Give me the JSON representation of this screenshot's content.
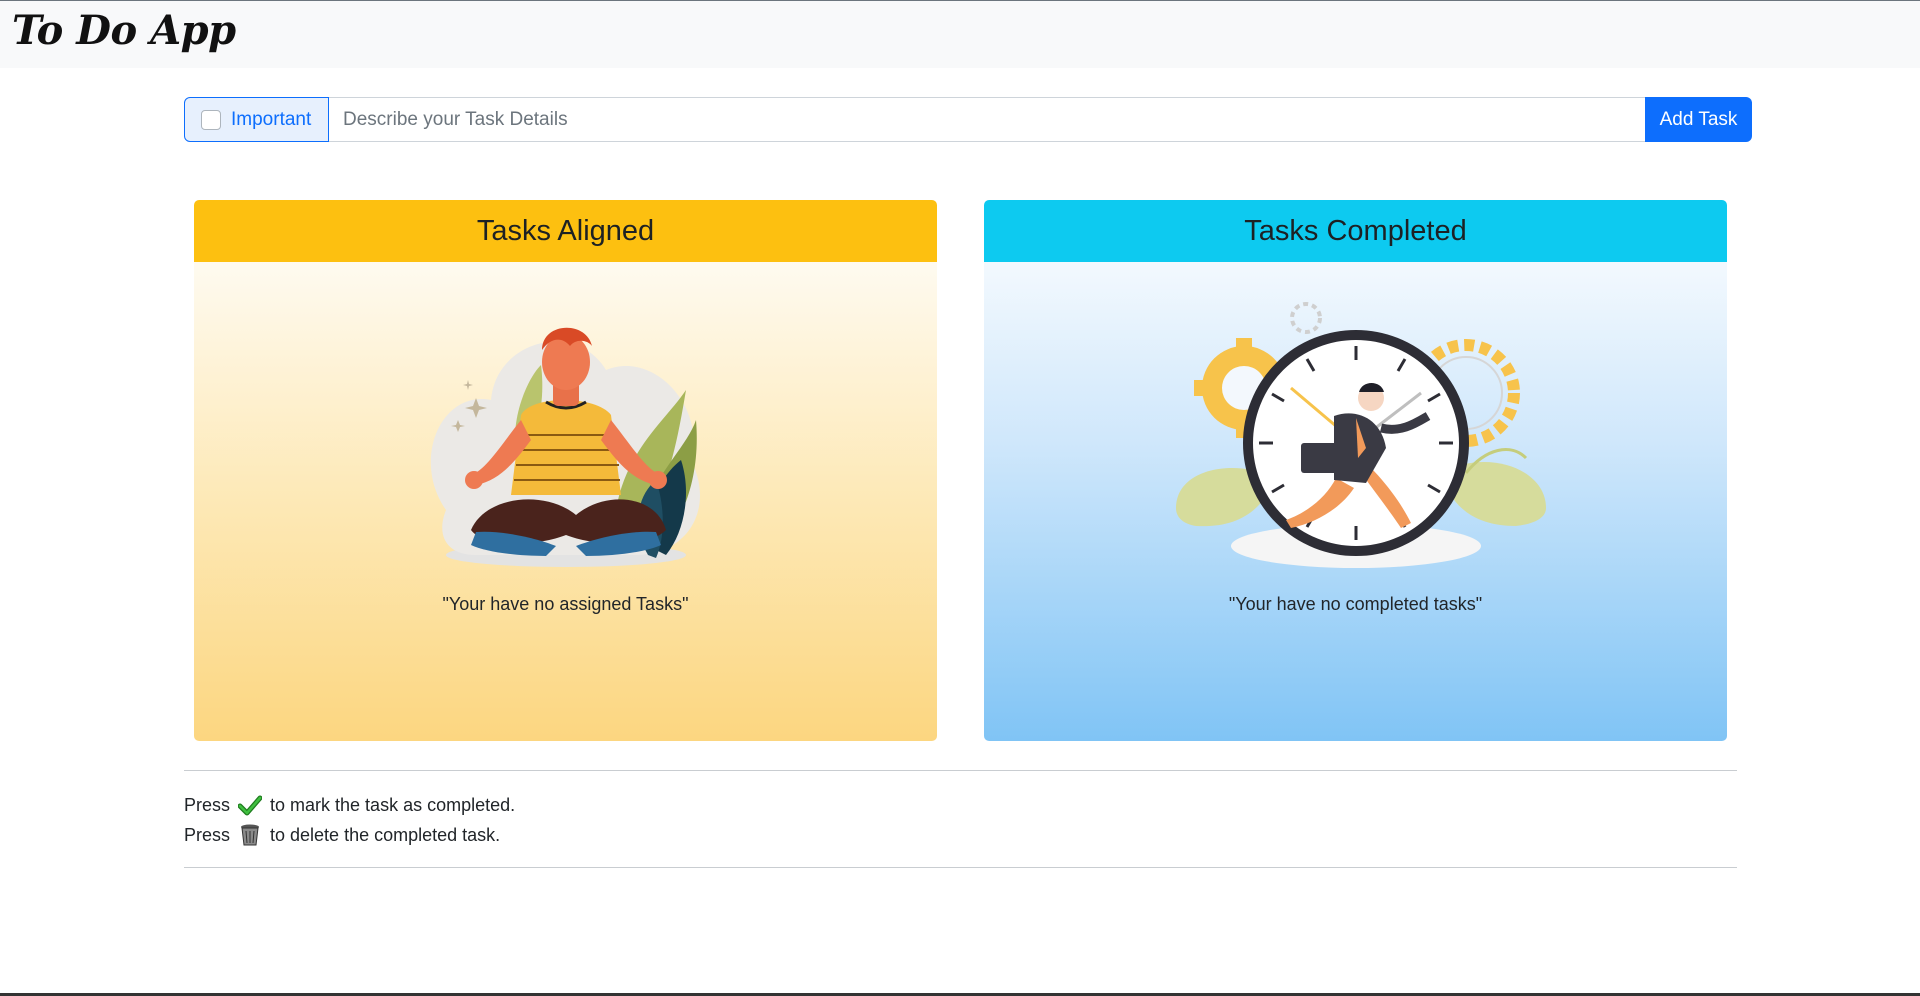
{
  "app": {
    "title": "To Do App"
  },
  "form": {
    "important_label": "Important",
    "task_placeholder": "Describe your Task Details",
    "add_button": "Add Task"
  },
  "cards": {
    "aligned": {
      "title": "Tasks Aligned",
      "empty_message": "\"Your have no assigned Tasks\""
    },
    "completed": {
      "title": "Tasks Completed",
      "empty_message": "\"Your have no completed tasks\""
    }
  },
  "legend": {
    "complete": {
      "prefix": "Press",
      "suffix": "to mark the task as completed.",
      "icon": "checkmark-icon"
    },
    "delete": {
      "prefix": "Press",
      "suffix": "to delete the completed task.",
      "icon": "trash-icon"
    }
  },
  "colors": {
    "accent": "#0d6efd",
    "aligned_header": "#fdc010",
    "completed_header": "#0dcaf0"
  }
}
